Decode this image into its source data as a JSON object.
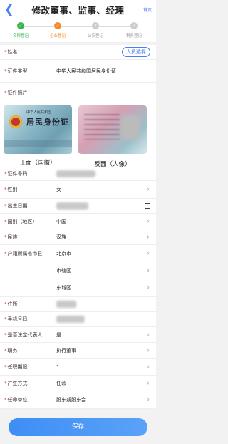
{
  "header": {
    "title": "修改董事、监事、经理",
    "home_label": "首页"
  },
  "steps": [
    {
      "label": "名称登记",
      "state": "done"
    },
    {
      "label": "企业登记",
      "state": "active"
    },
    {
      "label": "公安登记",
      "state": "pending"
    },
    {
      "label": "税务登记",
      "state": "pending"
    }
  ],
  "form": {
    "name_label": "姓名",
    "pick_person": "人员选择",
    "id_type_label": "证件类型",
    "id_type_value": "中华人民共和国居民身份证",
    "id_photo_label": "证件照片",
    "photo_front_caption": "正面（国徽）",
    "photo_back_caption": "反面（人像）",
    "card_line1": "中华人民共和国",
    "card_line2": "居民身份证",
    "id_number_label": "证件号码",
    "gender_label": "性别",
    "gender_value": "女",
    "birth_label": "出生日期",
    "nation_label": "国别（地区）",
    "nation_value": "中国",
    "ethnic_label": "民族",
    "ethnic_value": "汉族",
    "hukou_label": "户籍所属省市县",
    "hukou_province": "北京市",
    "hukou_city": "市辖区",
    "hukou_district": "东城区",
    "address_label": "住所",
    "phone_label": "手机号码",
    "legal_rep_label": "是否法定代表人",
    "legal_rep_value": "是",
    "position_label": "职务",
    "position_value": "执行董事",
    "term_label": "任职期限",
    "term_value": "1",
    "method_label": "产生方式",
    "method_value": "任命",
    "appoint_unit_label": "任命单位",
    "appoint_unit_value": "股东或股东会"
  },
  "save_label": "保存"
}
